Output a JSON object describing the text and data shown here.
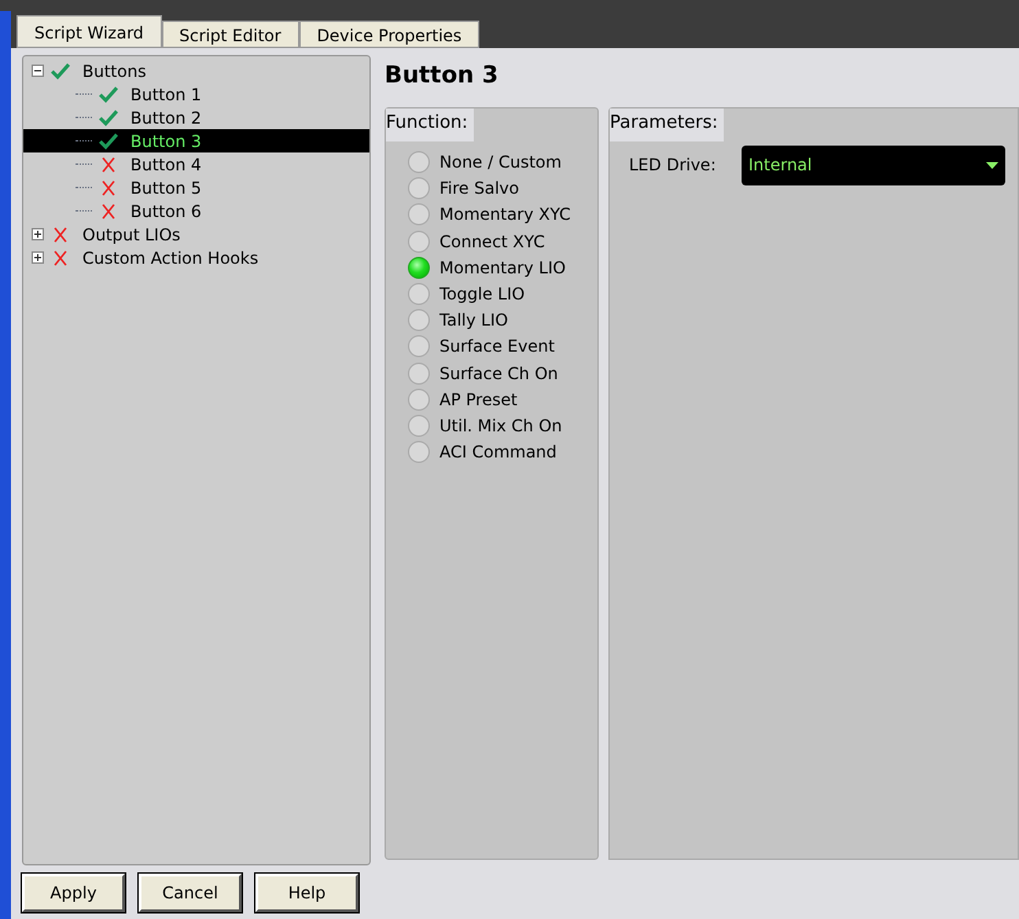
{
  "tabs": [
    {
      "label": "Script Wizard",
      "selected": true
    },
    {
      "label": "Script Editor",
      "selected": false
    },
    {
      "label": "Device Properties",
      "selected": false
    }
  ],
  "tree": [
    {
      "label": "Buttons",
      "ok": true,
      "expanded": true,
      "selected": false,
      "children": [
        {
          "label": "Button 1",
          "ok": true,
          "selected": false
        },
        {
          "label": "Button 2",
          "ok": true,
          "selected": false
        },
        {
          "label": "Button 3",
          "ok": true,
          "selected": true
        },
        {
          "label": "Button 4",
          "ok": false,
          "selected": false
        },
        {
          "label": "Button 5",
          "ok": false,
          "selected": false
        },
        {
          "label": "Button 6",
          "ok": false,
          "selected": false
        }
      ]
    },
    {
      "label": "Output LIOs",
      "ok": false,
      "expanded": false,
      "selected": false
    },
    {
      "label": "Custom Action Hooks",
      "ok": false,
      "expanded": false,
      "selected": false
    }
  ],
  "title": "Button 3",
  "function": {
    "label": "Function:",
    "options": [
      {
        "label": "None / Custom",
        "selected": false
      },
      {
        "label": "Fire Salvo",
        "selected": false
      },
      {
        "label": "Momentary XYC",
        "selected": false
      },
      {
        "label": "Connect XYC",
        "selected": false
      },
      {
        "label": "Momentary LIO",
        "selected": true
      },
      {
        "label": "Toggle LIO",
        "selected": false
      },
      {
        "label": "Tally LIO",
        "selected": false
      },
      {
        "label": "Surface Event",
        "selected": false
      },
      {
        "label": "Surface Ch On",
        "selected": false
      },
      {
        "label": "AP Preset",
        "selected": false
      },
      {
        "label": "Util. Mix Ch On",
        "selected": false
      },
      {
        "label": "ACI Command",
        "selected": false
      }
    ]
  },
  "parameters": {
    "label": "Parameters:",
    "led_drive": {
      "label": "LED Drive:",
      "value": "Internal"
    }
  },
  "buttons": [
    "Apply",
    "Cancel",
    "Help"
  ]
}
